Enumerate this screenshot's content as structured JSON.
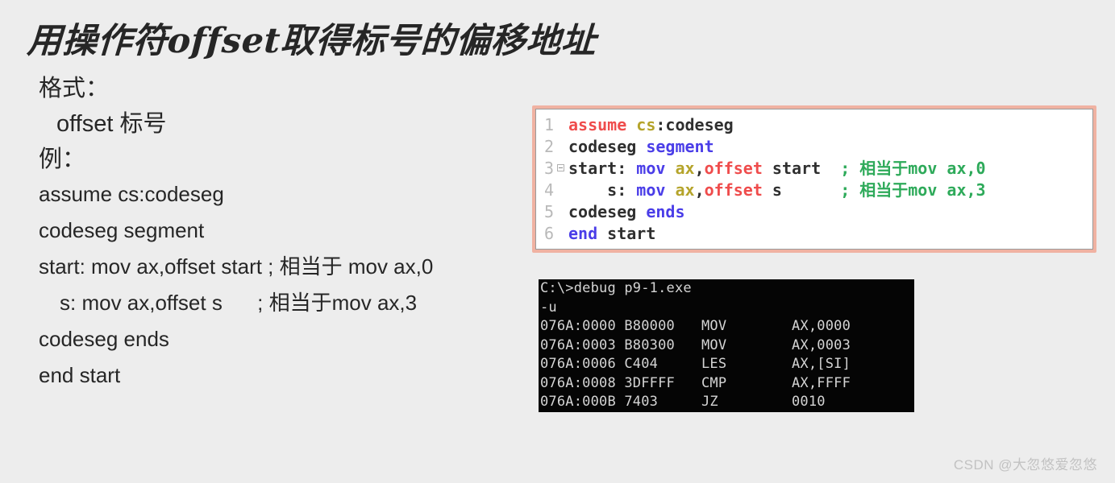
{
  "slide": {
    "title": "用操作符offset取得标号的偏移地址",
    "background_color": "#ededed",
    "text_color": "#262626"
  },
  "body": {
    "lines": [
      {
        "text": "格式：",
        "level": 1,
        "indent": false
      },
      {
        "text": "offset 标号",
        "level": 1,
        "indent": true
      },
      {
        "text": "例：",
        "level": 1,
        "indent": false
      },
      {
        "text": "assume cs:codeseg",
        "level": 2,
        "indent": false
      },
      {
        "text": "codeseg segment",
        "level": 2,
        "indent": false
      },
      {
        "text": "start: mov ax,offset start ; 相当于 mov ax,0",
        "level": 2,
        "indent": false
      },
      {
        "text": "s: mov ax,offset s      ; 相当于mov ax,3",
        "level": 2,
        "indent": true
      },
      {
        "text": "codeseg ends",
        "level": 2,
        "indent": false
      },
      {
        "text": "end start",
        "level": 2,
        "indent": false
      }
    ]
  },
  "code_panel": {
    "border_color": "#f0b2a2",
    "background_color": "#ffffff",
    "colors": {
      "keyword_red": "#ef4c4c",
      "register_olive": "#b5a42b",
      "instruction_blue": "#4a3de8",
      "plain_dark": "#2f2f2f",
      "comment_green": "#2eaa5a",
      "line_number": "#b9b9b9"
    },
    "lines": [
      {
        "number": "1",
        "fold": false,
        "tokens": [
          {
            "t": "assume",
            "c": "red"
          },
          {
            "t": " ",
            "c": "dark"
          },
          {
            "t": "cs",
            "c": "olive"
          },
          {
            "t": ":codeseg",
            "c": "dark"
          }
        ]
      },
      {
        "number": "2",
        "fold": false,
        "tokens": [
          {
            "t": "codeseg ",
            "c": "dark"
          },
          {
            "t": "segment",
            "c": "blue"
          }
        ]
      },
      {
        "number": "3",
        "fold": true,
        "tokens": [
          {
            "t": "start: ",
            "c": "dark"
          },
          {
            "t": "mov",
            "c": "blue"
          },
          {
            "t": " ",
            "c": "dark"
          },
          {
            "t": "ax",
            "c": "olive"
          },
          {
            "t": ",",
            "c": "dark"
          },
          {
            "t": "offset",
            "c": "red"
          },
          {
            "t": " start  ",
            "c": "dark"
          },
          {
            "t": "; 相当于mov ax,0",
            "c": "green"
          }
        ]
      },
      {
        "number": "4",
        "fold": false,
        "tokens": [
          {
            "t": "    s: ",
            "c": "dark"
          },
          {
            "t": "mov",
            "c": "blue"
          },
          {
            "t": " ",
            "c": "dark"
          },
          {
            "t": "ax",
            "c": "olive"
          },
          {
            "t": ",",
            "c": "dark"
          },
          {
            "t": "offset",
            "c": "red"
          },
          {
            "t": " s      ",
            "c": "dark"
          },
          {
            "t": "; 相当于mov ax,3",
            "c": "green"
          }
        ]
      },
      {
        "number": "5",
        "fold": false,
        "tokens": [
          {
            "t": "codeseg ",
            "c": "dark"
          },
          {
            "t": "ends",
            "c": "blue"
          }
        ]
      },
      {
        "number": "6",
        "fold": false,
        "tokens": [
          {
            "t": "end",
            "c": "blue"
          },
          {
            "t": " start",
            "c": "dark"
          }
        ]
      }
    ]
  },
  "console": {
    "background_color": "#050505",
    "text_color": "#d4d4d4",
    "prompt_lines": [
      "C:\\>debug p9-1.exe",
      "-u"
    ],
    "disassembly_headers": [
      "address",
      "bytes",
      "mnemonic",
      "operands"
    ],
    "disassembly": [
      {
        "address": "076A:0000",
        "bytes": "B80000",
        "mnemonic": "MOV",
        "operands": "AX,0000"
      },
      {
        "address": "076A:0003",
        "bytes": "B80300",
        "mnemonic": "MOV",
        "operands": "AX,0003"
      },
      {
        "address": "076A:0006",
        "bytes": "C404",
        "mnemonic": "LES",
        "operands": "AX,[SI]"
      },
      {
        "address": "076A:0008",
        "bytes": "3DFFFF",
        "mnemonic": "CMP",
        "operands": "AX,FFFF"
      },
      {
        "address": "076A:000B",
        "bytes": "7403",
        "mnemonic": "JZ",
        "operands": "0010"
      }
    ]
  },
  "watermark": {
    "text": "CSDN @大忽悠爱忽悠"
  }
}
